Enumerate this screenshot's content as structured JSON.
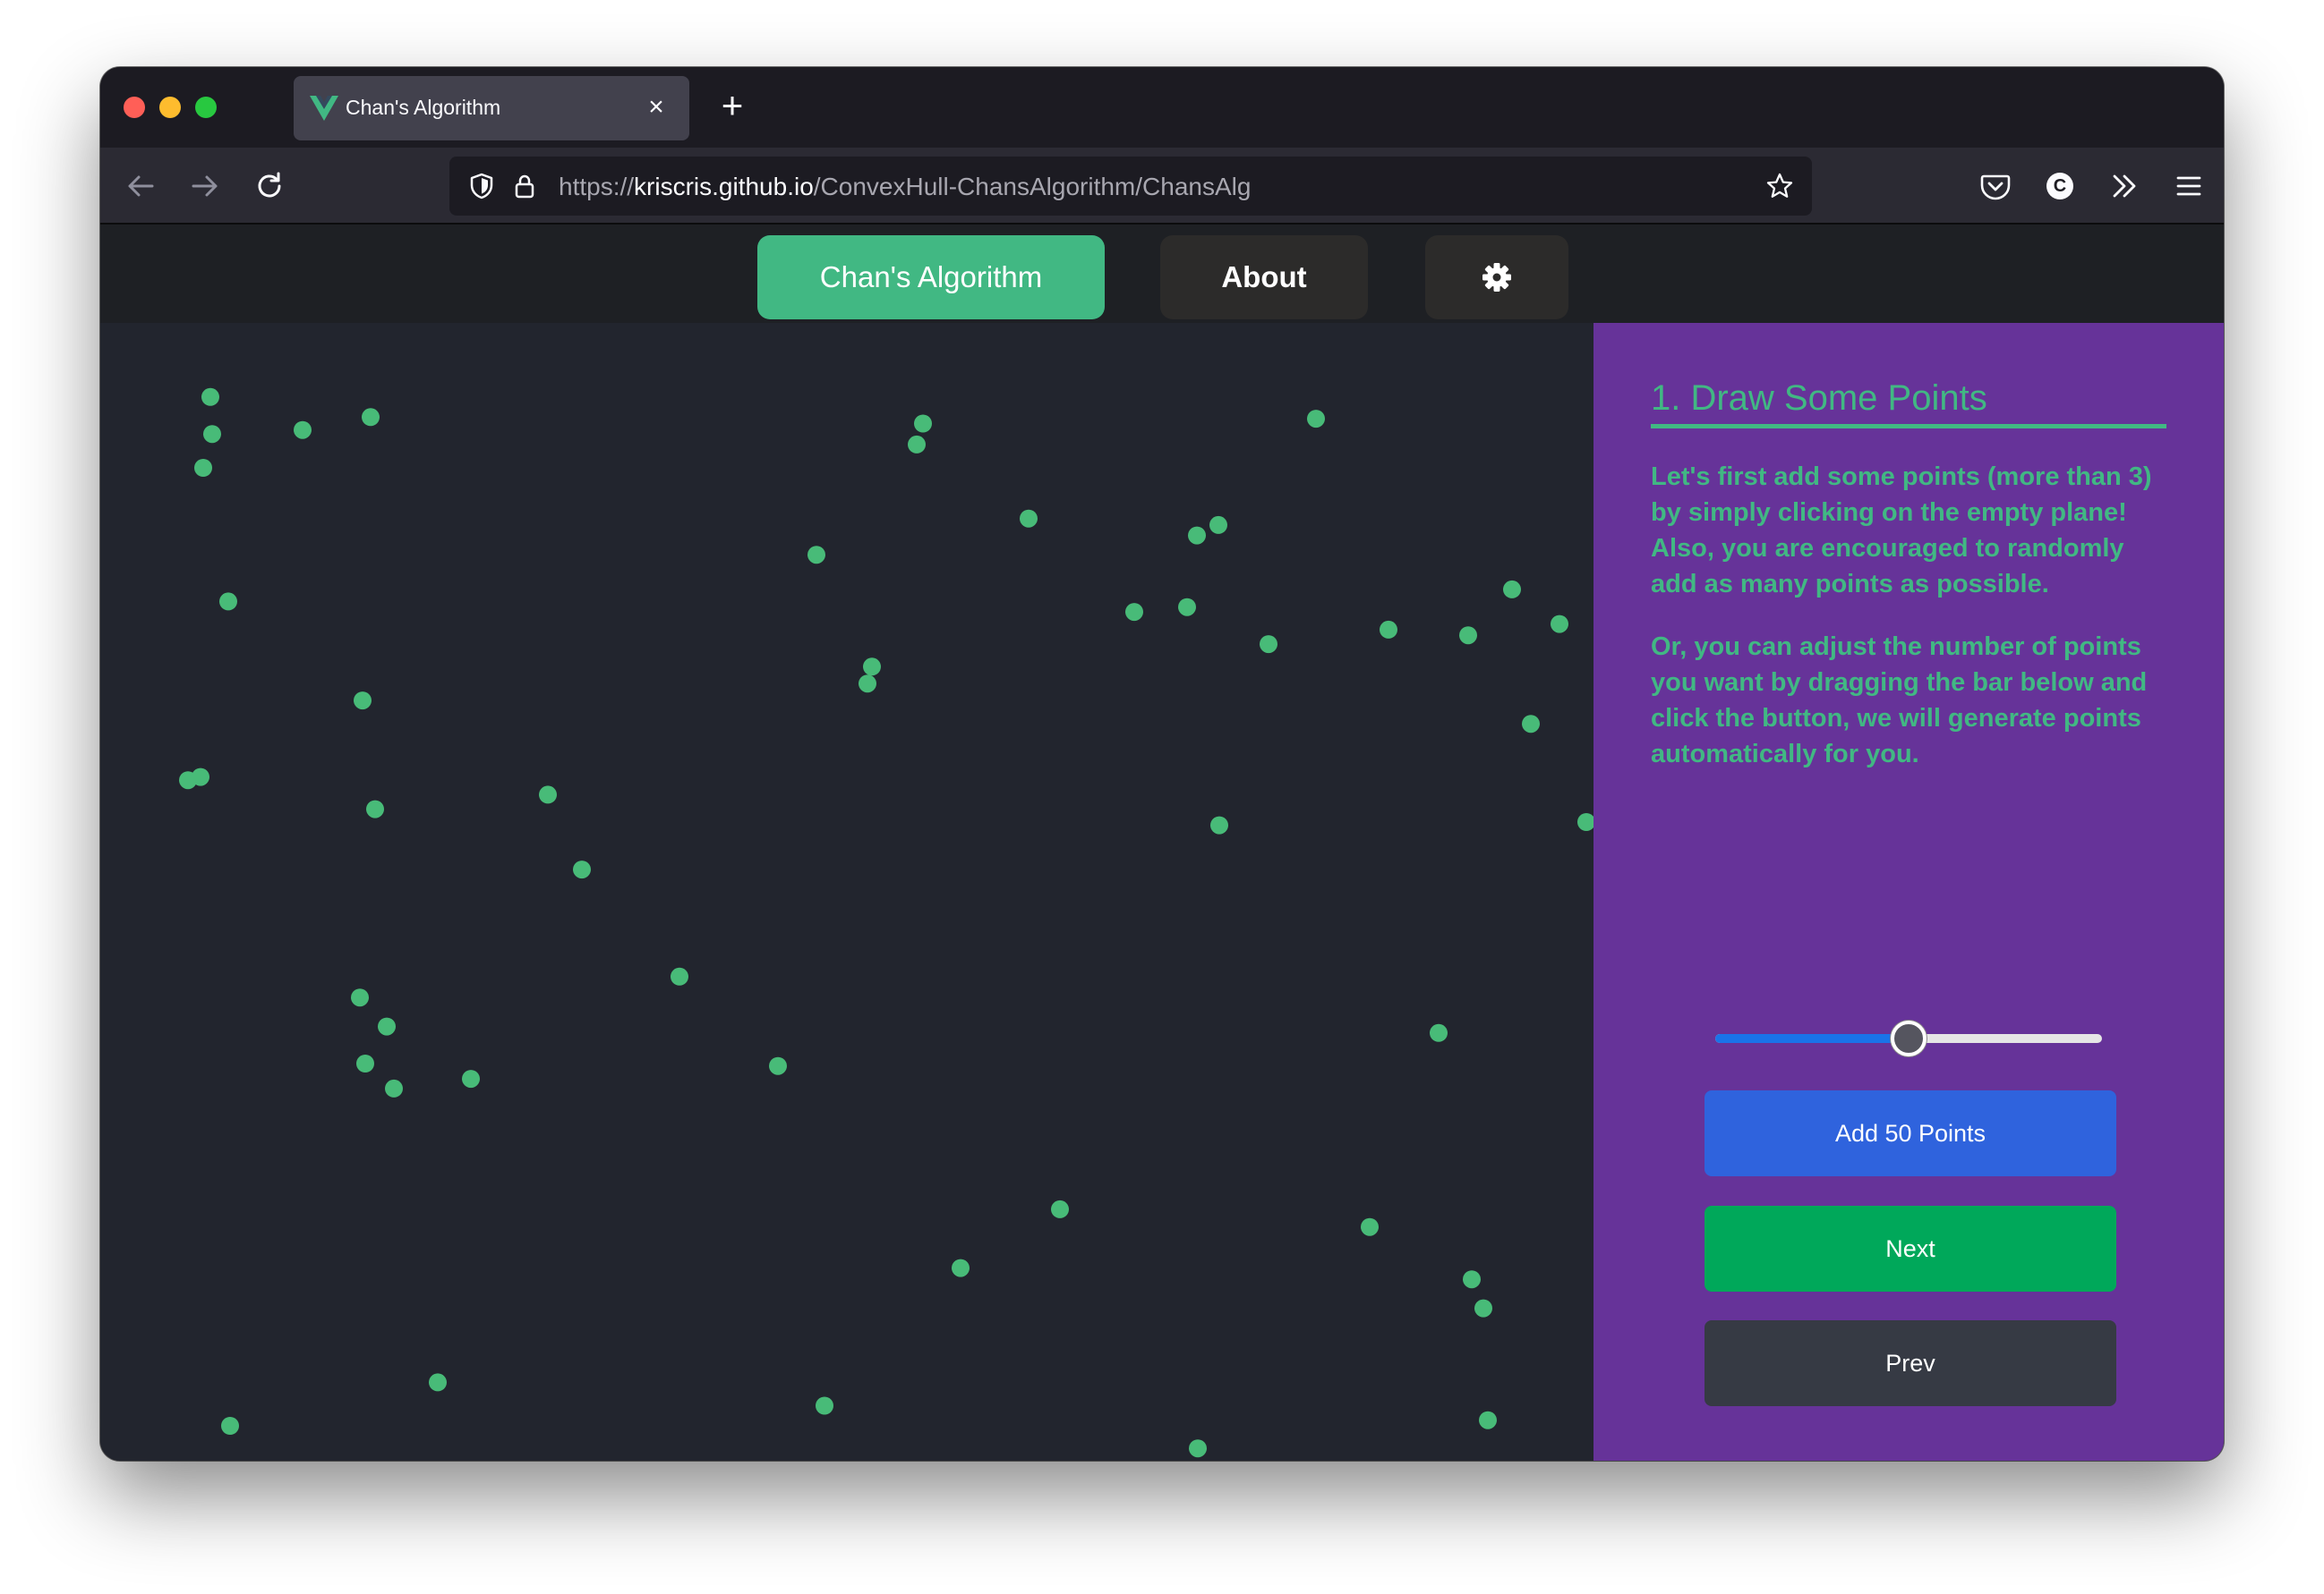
{
  "browser": {
    "tab_title": "Chan's Algorithm",
    "new_tab_label": "+",
    "close_label": "×",
    "url_scheme": "https://",
    "url_host": "kriscris.github.io",
    "url_path": "/ConvexHull-ChansAlgorithm/ChansAlg",
    "account_initial": "C"
  },
  "header": {
    "nav_chans": "Chan's Algorithm",
    "nav_about": "About",
    "settings_icon": "gear-icon"
  },
  "panel": {
    "title": "1. Draw Some Points",
    "paragraph1": "Let's first add some points (more than 3) by simply clicking on the empty plane! Also, you are encouraged to randomly add as many points as possible.",
    "paragraph2": "Or, you can adjust the number of points you want by dragging the bar below and click the button, we will generate points automatically for you.",
    "slider_value_fraction": 0.5,
    "add_button": "Add 50 Points",
    "next_button": "Next",
    "prev_button": "Prev"
  },
  "colors": {
    "accent": "#41b883",
    "panel_bg": "#663399",
    "canvas_bg": "#22252e",
    "point": "#48bb78",
    "add_button": "#2f63dd",
    "next_button": "#00a85a",
    "prev_button": "#363a44"
  }
}
